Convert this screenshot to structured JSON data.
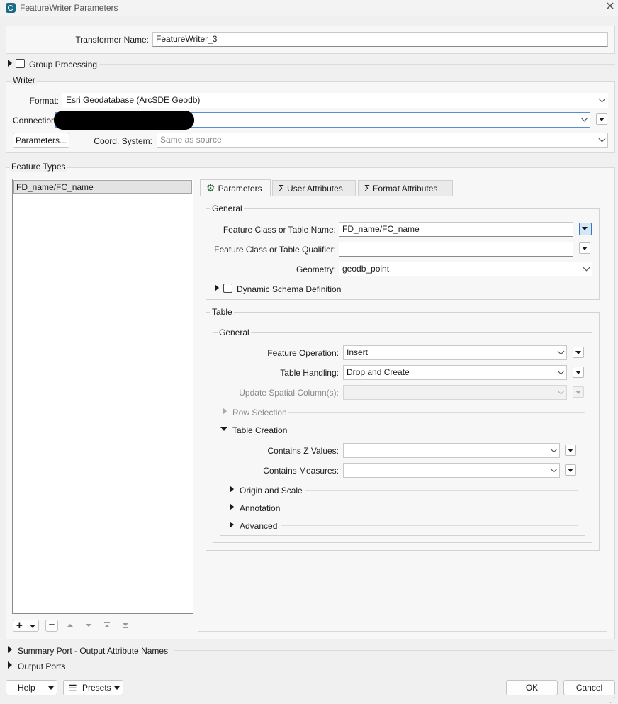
{
  "window": {
    "title": "FeatureWriter Parameters"
  },
  "transformer": {
    "label": "Transformer Name:",
    "value": "FeatureWriter_3"
  },
  "group_processing": {
    "label": "Group Processing"
  },
  "writer": {
    "title": "Writer",
    "format_label": "Format:",
    "format_value": "Esri Geodatabase (ArcSDE Geodb)",
    "connection_label": "Connection",
    "parameters_button": "Parameters...",
    "coord_label": "Coord. System:",
    "coord_placeholder": "Same as source"
  },
  "feature_types": {
    "title": "Feature Types",
    "items": [
      "FD_name/FC_name"
    ],
    "toolbar": {
      "add": "+",
      "remove": "−"
    }
  },
  "tabs": [
    {
      "label": "Parameters",
      "icon": "gear-icon"
    },
    {
      "label": "User Attributes",
      "icon": "sigma-icon"
    },
    {
      "label": "Format Attributes",
      "icon": "sigma-icon"
    }
  ],
  "general": {
    "title": "General",
    "fc_name_label": "Feature Class or Table Name:",
    "fc_name_value": "FD_name/FC_name",
    "qualifier_label": "Feature Class or Table Qualifier:",
    "qualifier_value": "",
    "geometry_label": "Geometry:",
    "geometry_value": "geodb_point",
    "dynamic_schema_label": "Dynamic Schema Definition"
  },
  "table": {
    "title": "Table",
    "general_title": "General",
    "feature_operation_label": "Feature Operation:",
    "feature_operation_value": "Insert",
    "table_handling_label": "Table Handling:",
    "table_handling_value": "Drop and Create",
    "update_spatial_label": "Update Spatial Column(s):",
    "row_selection_label": "Row Selection",
    "table_creation_title": "Table Creation",
    "contains_z_label": "Contains Z Values:",
    "contains_measures_label": "Contains Measures:",
    "origin_scale_label": "Origin and Scale",
    "annotation_label": "Annotation",
    "advanced_label": "Advanced"
  },
  "bottom": {
    "summary_port_label": "Summary Port - Output Attribute Names",
    "output_ports_label": "Output Ports",
    "help_button": "Help",
    "presets_button": "Presets",
    "ok_button": "OK",
    "cancel_button": "Cancel"
  },
  "colors": {
    "accent": "#3a77c2",
    "redaction": "#000000"
  }
}
